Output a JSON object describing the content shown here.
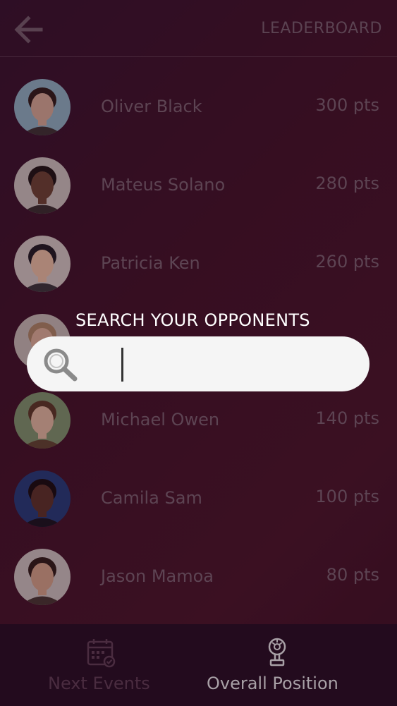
{
  "header": {
    "title": "LEADERBOARD",
    "back_icon": "arrow-left-icon"
  },
  "players": [
    {
      "name": "Oliver Black",
      "points": "300 pts",
      "skin": "#d9b097",
      "hair": "#2b1d16",
      "bg": "#8fb7c7"
    },
    {
      "name": "Mateus Solano",
      "points": "280 pts",
      "skin": "#6b4430",
      "hair": "#1a1310",
      "bg": "#cfc9c2"
    },
    {
      "name": "Patricia Ken",
      "points": "260 pts",
      "skin": "#f0c6a6",
      "hair": "#1b1b1f",
      "bg": "#d8d0c8"
    },
    {
      "name": "",
      "points": "",
      "skin": "#e2b79b",
      "hair": "#b08a66",
      "bg": "#c9c2b8"
    },
    {
      "name": "Michael Owen",
      "points": "140 pts",
      "skin": "#e7c1a4",
      "hair": "#5a3a24",
      "bg": "#7f9a6e"
    },
    {
      "name": "Camila Sam",
      "points": "100 pts",
      "skin": "#5a3425",
      "hair": "#120c0a",
      "bg": "#1f3d7a"
    },
    {
      "name": "Jason Mamoa",
      "points": "80 pts",
      "skin": "#d7a889",
      "hair": "#2c1c14",
      "bg": "#cfcac4"
    }
  ],
  "search": {
    "label": "SEARCH YOUR OPPONENTS",
    "placeholder": "",
    "value": "",
    "icon": "search-icon"
  },
  "bottom_nav": {
    "events_label": "Next Events",
    "events_icon": "calendar-icon",
    "position_label": "Overall Position",
    "position_icon": "trophy-icon"
  },
  "colors": {
    "accent_text": "#ffffff",
    "muted_text": "#7a6470",
    "nav_bg": "#230b1e"
  }
}
